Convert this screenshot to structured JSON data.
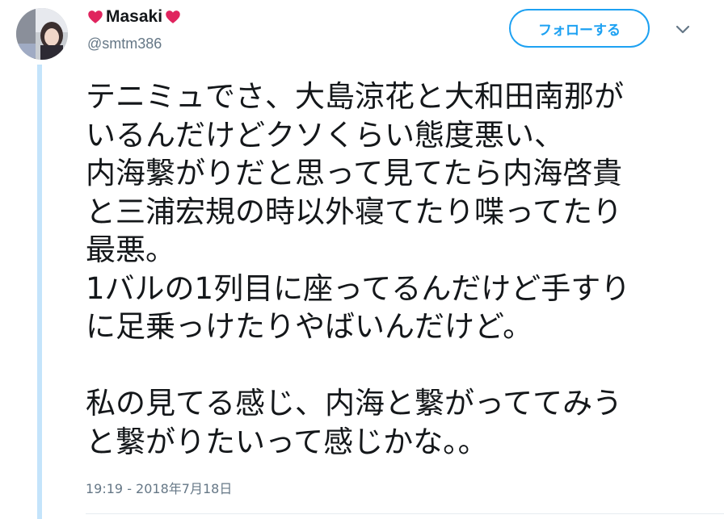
{
  "tweet": {
    "author": {
      "display_name": "Masaki",
      "handle": "@smtm386",
      "name_decoration": "heart-icon",
      "heart_color": "#e0245e"
    },
    "follow_button_label": "フォローする",
    "menu_icon": "chevron-down-icon",
    "text_lines": [
      "テニミュでさ、大島涼花と大和田南那が",
      "いるんだけどクソくらい態度悪い、",
      "内海繋がりだと思って見てたら内海啓貴",
      "と三浦宏規の時以外寝てたり喋ってたり",
      "最悪。",
      "1バルの1列目に座ってるんだけど手すり",
      "に足乗っけたりやばいんだけど。",
      "",
      "私の見てる感じ、内海と繋がっててみう",
      "と繋がりたいって感じかな。。"
    ],
    "timestamp": "19:19 - 2018年7月18日"
  },
  "colors": {
    "accent": "#1da1f2",
    "thread_line": "#c4e4fb",
    "secondary_text": "#657786",
    "primary_text": "#14171a"
  }
}
